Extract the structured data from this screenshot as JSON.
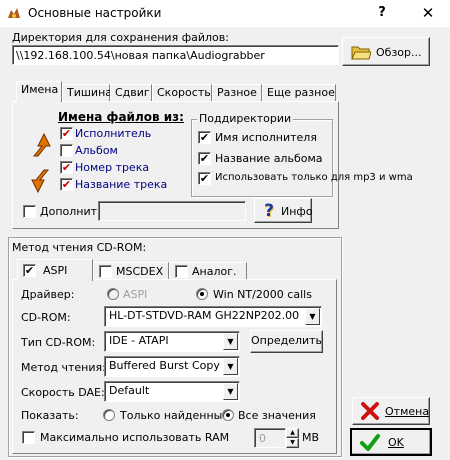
{
  "window": {
    "title": "Основные настройки",
    "help_label": "?",
    "close_label": "✕"
  },
  "directory": {
    "label": "Директория для сохранения файлов:",
    "value": "\\\\192.168.100.54\\новая папка\\Audiograbber",
    "browse_label": "Обзор..."
  },
  "tabs": [
    {
      "label": "Имена"
    },
    {
      "label": "Тишина"
    },
    {
      "label": "Сдвиг"
    },
    {
      "label": "Скорость"
    },
    {
      "label": "Разное"
    },
    {
      "label": "Еще разное"
    }
  ],
  "names": {
    "heading": "Имена файлов из:",
    "items": [
      {
        "label": "Исполнитель",
        "checked": true
      },
      {
        "label": "Альбом",
        "checked": false
      },
      {
        "label": "Номер трека",
        "checked": true
      },
      {
        "label": "Название трека",
        "checked": true
      }
    ],
    "subdirs": {
      "heading": "Поддиректории",
      "items": [
        {
          "label": "Имя исполнителя",
          "checked": true
        },
        {
          "label": "Название альбома",
          "checked": true
        },
        {
          "label": "Использовать только для mp3 и wma",
          "checked": true
        }
      ]
    },
    "extra_label": "Дополнит.",
    "extra_value": "",
    "info_label": "Инфо"
  },
  "cdrom": {
    "group_label": "Метод чтения CD-ROM:",
    "tabs": [
      {
        "label": "ASPI",
        "checked": true
      },
      {
        "label": "MSCDEX",
        "checked": false
      },
      {
        "label": "Аналог.",
        "checked": false
      }
    ],
    "driver_label": "Драйвер:",
    "driver_aspi": "ASPI",
    "driver_win": "Win NT/2000 calls",
    "cdrom_label": "CD-ROM:",
    "cdrom_value": "HL-DT-STDVD-RAM GH22NP202.00",
    "type_label": "Тип CD-ROM:",
    "type_value": "IDE   - ATAPI",
    "detect_label": "Определить",
    "method_label": "Метод чтения:",
    "method_value": "Buffered Burst Copy",
    "dae_label": "Скорость DAE:",
    "dae_value": "Default",
    "show_label": "Показать:",
    "show_found": "Только найденные",
    "show_all": "Все значения",
    "max_ram_label": "Максимально использовать RAM",
    "ram_value": "0",
    "ram_unit": "MB"
  },
  "buttons": {
    "cancel_label": "Отмена",
    "ok_label": "OK"
  },
  "colors": {
    "check_red": "#c00000",
    "link_blue": "#00007f"
  }
}
